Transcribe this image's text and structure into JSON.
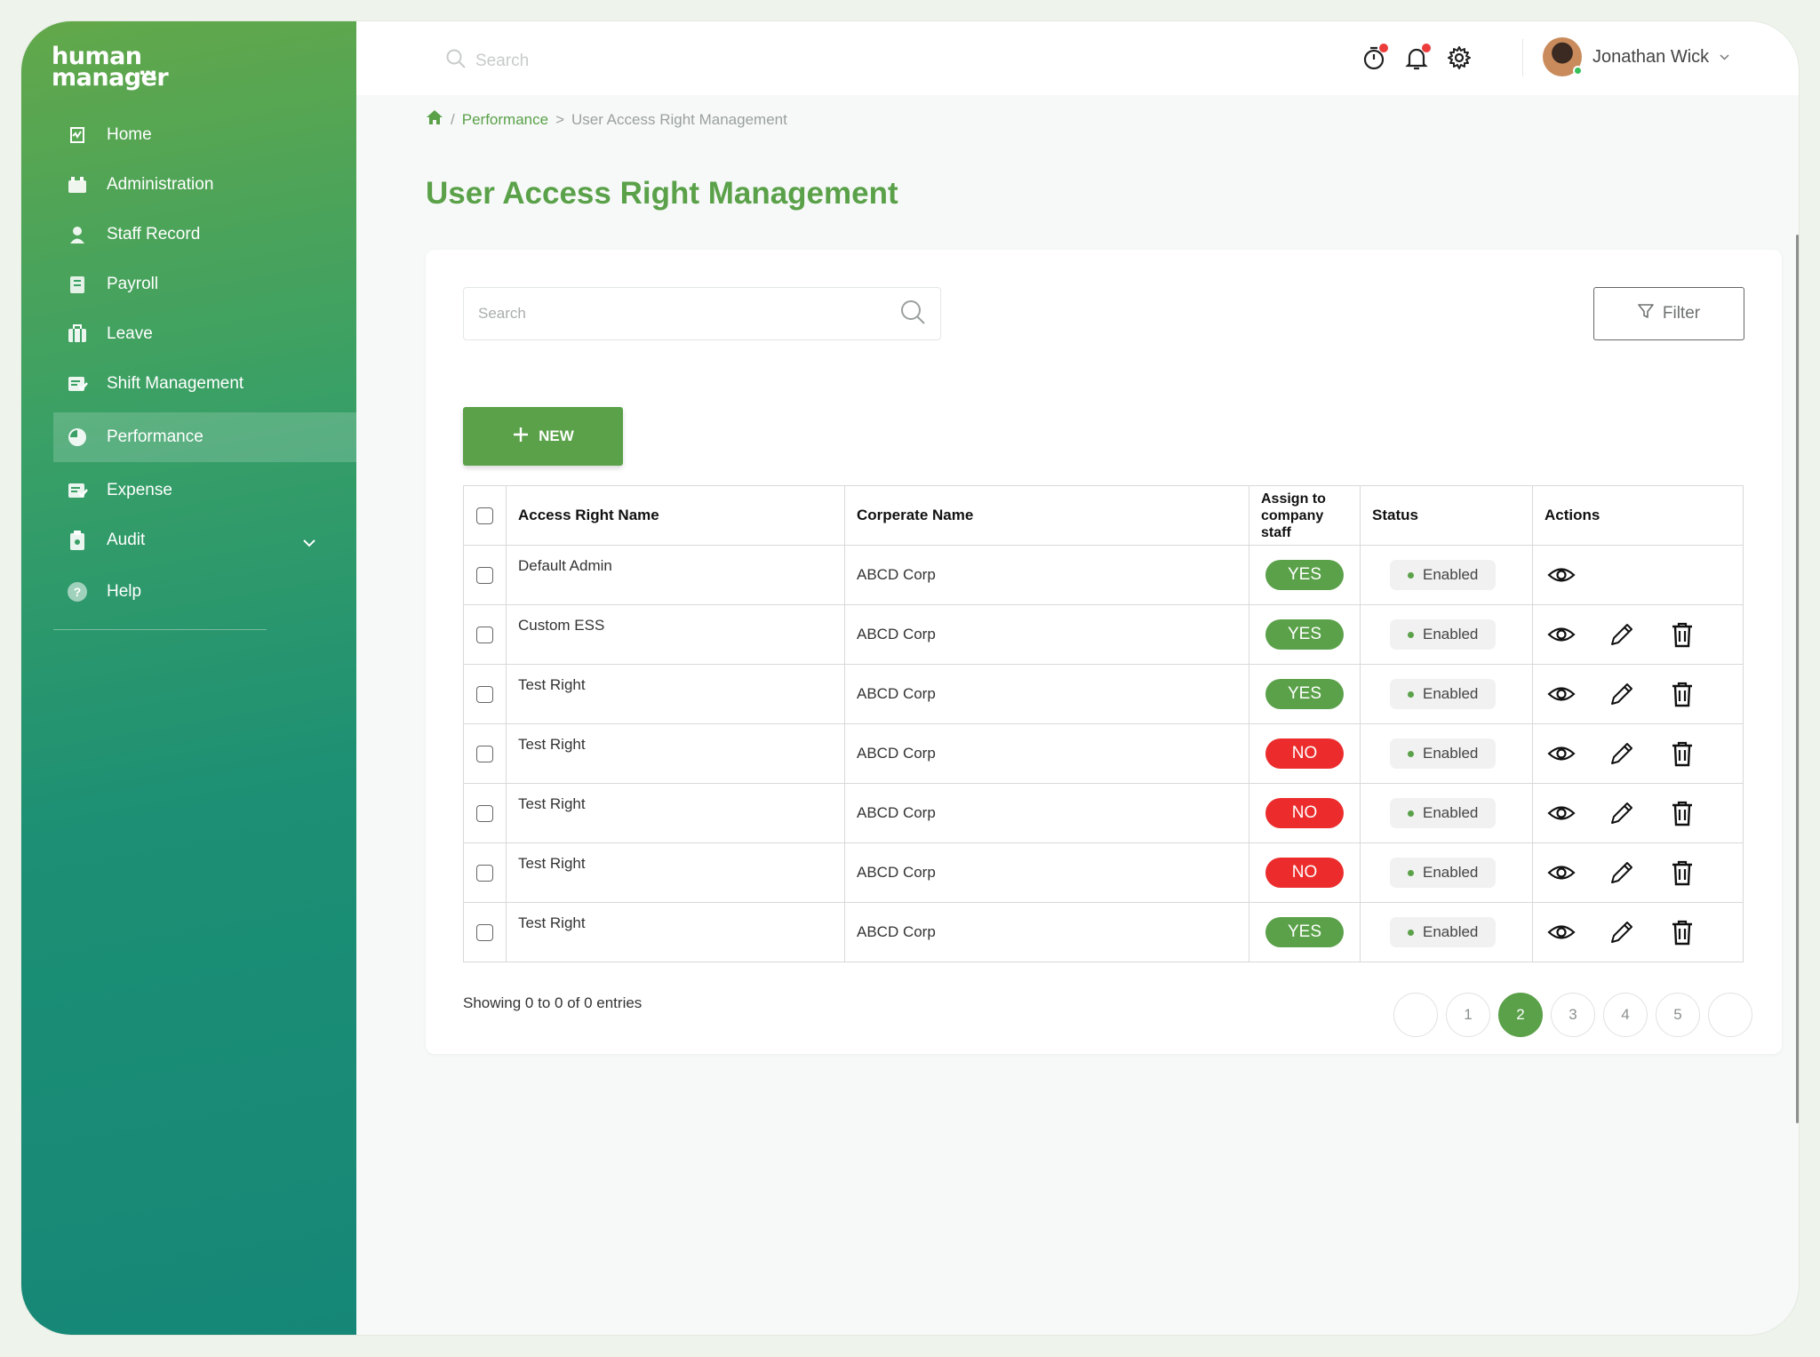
{
  "brand": {
    "line1": "human",
    "line2": "manager",
    "dots": "..."
  },
  "sidebar": {
    "items": [
      {
        "label": "Home",
        "icon": "home-icon"
      },
      {
        "label": "Administration",
        "icon": "administration-icon"
      },
      {
        "label": "Staff Record",
        "icon": "staff-icon"
      },
      {
        "label": "Payroll",
        "icon": "payroll-icon"
      },
      {
        "label": "Leave",
        "icon": "leave-icon"
      },
      {
        "label": "Shift Management",
        "icon": "shift-icon"
      },
      {
        "label": "Performance",
        "icon": "performance-icon",
        "active": true
      },
      {
        "label": "Expense",
        "icon": "expense-icon"
      },
      {
        "label": "Audit",
        "icon": "audit-icon",
        "expandable": true
      },
      {
        "label": "Help",
        "icon": "help-icon"
      }
    ]
  },
  "topbar": {
    "search_placeholder": "Search",
    "user_name": "Jonathan Wick"
  },
  "breadcrumb": {
    "level1": "Performance",
    "level2": "User Access Right Management"
  },
  "page_title": "User Access Right Management",
  "toolbar": {
    "search_placeholder": "Search",
    "filter_label": "Filter",
    "new_label": "NEW"
  },
  "table": {
    "headers": {
      "name": "Access Right Name",
      "corporate": "Corperate Name",
      "assign": "Assign to company staff",
      "status": "Status",
      "actions": "Actions"
    },
    "rows": [
      {
        "name": "Default Admin",
        "corporate": "ABCD Corp",
        "assign": "YES",
        "status": "Enabled",
        "editable": false
      },
      {
        "name": "Custom ESS",
        "corporate": "ABCD Corp",
        "assign": "YES",
        "status": "Enabled",
        "editable": true
      },
      {
        "name": "Test Right",
        "corporate": "ABCD Corp",
        "assign": "YES",
        "status": "Enabled",
        "editable": true
      },
      {
        "name": "Test Right",
        "corporate": "ABCD Corp",
        "assign": "NO",
        "status": "Enabled",
        "editable": true
      },
      {
        "name": "Test Right",
        "corporate": "ABCD Corp",
        "assign": "NO",
        "status": "Enabled",
        "editable": true
      },
      {
        "name": "Test Right",
        "corporate": "ABCD Corp",
        "assign": "NO",
        "status": "Enabled",
        "editable": true
      },
      {
        "name": "Test Right",
        "corporate": "ABCD Corp",
        "assign": "YES",
        "status": "Enabled",
        "editable": true
      }
    ]
  },
  "footer": {
    "entries_text": "Showing 0 to 0 of 0 entries",
    "pages": [
      "",
      "1",
      "2",
      "3",
      "4",
      "5",
      ""
    ],
    "current_page": "2"
  },
  "colors": {
    "accent": "#5aa149",
    "danger": "#ec2c2c",
    "sidebar_from": "#63a84a",
    "sidebar_to": "#168777"
  }
}
